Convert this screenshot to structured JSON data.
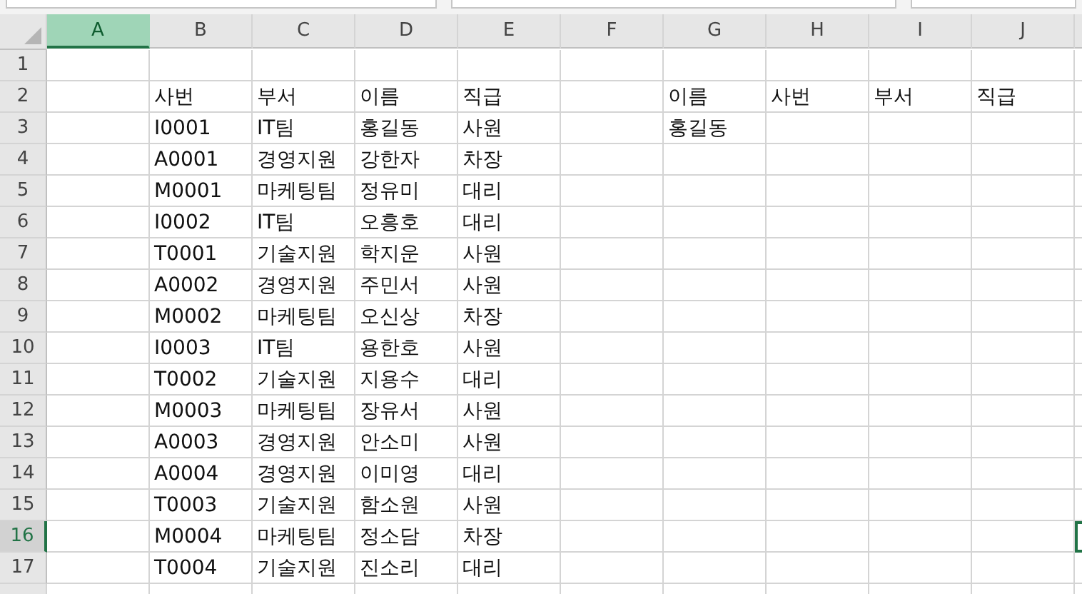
{
  "columns": [
    {
      "label": "A",
      "selected": true
    },
    {
      "label": "B",
      "selected": false
    },
    {
      "label": "C",
      "selected": false
    },
    {
      "label": "D",
      "selected": false
    },
    {
      "label": "E",
      "selected": false
    },
    {
      "label": "F",
      "selected": false
    },
    {
      "label": "G",
      "selected": false
    },
    {
      "label": "H",
      "selected": false
    },
    {
      "label": "I",
      "selected": false
    },
    {
      "label": "J",
      "selected": false
    }
  ],
  "rows": [
    {
      "number": "1",
      "selected": false
    },
    {
      "number": "2",
      "selected": false
    },
    {
      "number": "3",
      "selected": false
    },
    {
      "number": "4",
      "selected": false
    },
    {
      "number": "5",
      "selected": false
    },
    {
      "number": "6",
      "selected": false
    },
    {
      "number": "7",
      "selected": false
    },
    {
      "number": "8",
      "selected": false
    },
    {
      "number": "9",
      "selected": false
    },
    {
      "number": "10",
      "selected": false
    },
    {
      "number": "11",
      "selected": false
    },
    {
      "number": "12",
      "selected": false
    },
    {
      "number": "13",
      "selected": false
    },
    {
      "number": "14",
      "selected": false
    },
    {
      "number": "15",
      "selected": false
    },
    {
      "number": "16",
      "selected": true
    },
    {
      "number": "17",
      "selected": false
    }
  ],
  "employee_table": {
    "header": [
      "사번",
      "부서",
      "이름",
      "직급"
    ],
    "rows": [
      [
        "I0001",
        "IT팀",
        "홍길동",
        "사원"
      ],
      [
        "A0001",
        "경영지원",
        "강한자",
        "차장"
      ],
      [
        "M0001",
        "마케팅팀",
        "정유미",
        "대리"
      ],
      [
        "I0002",
        "IT팀",
        "오흥호",
        "대리"
      ],
      [
        "T0001",
        "기술지원",
        "학지운",
        "사원"
      ],
      [
        "A0002",
        "경영지원",
        "주민서",
        "사원"
      ],
      [
        "M0002",
        "마케팅팀",
        "오신상",
        "차장"
      ],
      [
        "I0003",
        "IT팀",
        "용한호",
        "사원"
      ],
      [
        "T0002",
        "기술지원",
        "지용수",
        "대리"
      ],
      [
        "M0003",
        "마케팅팀",
        "장유서",
        "사원"
      ],
      [
        "A0003",
        "경영지원",
        "안소미",
        "사원"
      ],
      [
        "A0004",
        "경영지원",
        "이미영",
        "대리"
      ],
      [
        "T0003",
        "기술지원",
        "함소원",
        "사원"
      ],
      [
        "M0004",
        "마케팅팀",
        "정소담",
        "차장"
      ],
      [
        "T0004",
        "기술지원",
        "진소리",
        "대리"
      ]
    ]
  },
  "lookup_table": {
    "header": [
      "이름",
      "사번",
      "부서",
      "직급"
    ],
    "rows": [
      [
        "홍길동"
      ]
    ]
  }
}
